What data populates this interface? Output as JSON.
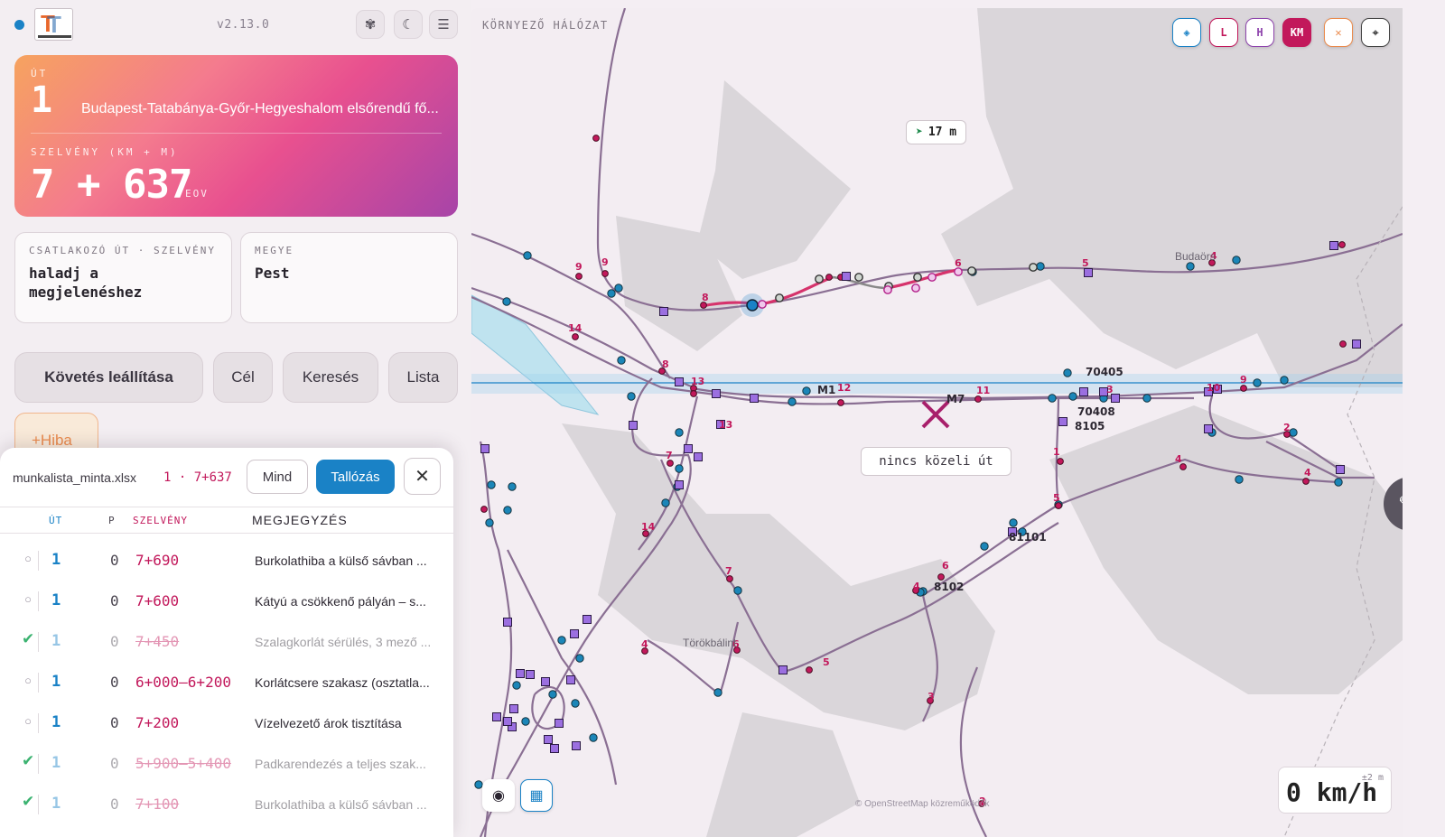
{
  "header": {
    "version": "v2.13.0",
    "icons": [
      "palette-icon",
      "moon-icon",
      "menu-icon"
    ]
  },
  "road_card": {
    "label": "ÚT",
    "number": "1",
    "name": "Budapest-Tatabánya-Győr-Hegyeshalom elsőrendű fő...",
    "km_label": "SZELVÉNY (KM + M)",
    "km_value": "7 + 637",
    "km_suffix": "EOV"
  },
  "junction": {
    "label": "CSATLAKOZÓ ÚT · SZELVÉNY",
    "value": "haladj a megjelenéshez"
  },
  "county": {
    "label": "MEGYE",
    "value": "Pest"
  },
  "actions": {
    "stop_tracking": "Követés leállítása",
    "target": "Cél",
    "search": "Keresés",
    "list": "Lista",
    "error": "+Hiba"
  },
  "worklist": {
    "file": "munkalista_minta.xlsx",
    "position": "1 · 7+637",
    "all_button": "Mind",
    "browse_button": "Tallózás",
    "columns": {
      "road": "ÚT",
      "p": "P",
      "km": "SZELVÉNY",
      "note": "MEGJEGYZÉS"
    },
    "rows": [
      {
        "status": "○",
        "done": false,
        "road": "1",
        "p": "0",
        "km": "7+690",
        "note": "Burkolathiba a külső sávban ..."
      },
      {
        "status": "○",
        "done": false,
        "road": "1",
        "p": "0",
        "km": "7+600",
        "note": "Kátyú a csökkenő pályán – s..."
      },
      {
        "status": "✔",
        "done": true,
        "road": "1",
        "p": "0",
        "km": "7+450",
        "note": "Szalagkorlát sérülés, 3 mező ..."
      },
      {
        "status": "○",
        "done": false,
        "road": "1",
        "p": "0",
        "km": "6+000–6+200",
        "note": "Korlátcsere szakasz (osztatla..."
      },
      {
        "status": "○",
        "done": false,
        "road": "1",
        "p": "0",
        "km": "7+200",
        "note": "Vízelvezető árok tisztítása"
      },
      {
        "status": "✔",
        "done": true,
        "road": "1",
        "p": "0",
        "km": "5+900–5+400",
        "note": "Padkarendezés a teljes szak..."
      },
      {
        "status": "✔",
        "done": true,
        "road": "1",
        "p": "0",
        "km": "7+100",
        "note": "Burkolathiba a külső sávban ..."
      }
    ]
  },
  "map": {
    "title": "KÖRNYEZŐ HÁLÓZAT",
    "tools": [
      {
        "label": "◈",
        "color": "#1a82c6"
      },
      {
        "label": "L",
        "color": "#c2185b"
      },
      {
        "label": "H",
        "color": "#8e44ad"
      },
      {
        "label": "KM",
        "color": "#ffffff",
        "bg": "#c2185b"
      },
      {
        "label": "✕",
        "color": "#ea8a4c"
      },
      {
        "label": "⌖",
        "color": "#444444"
      }
    ],
    "distance": "17 m",
    "no_road": "nincs közeli út",
    "speed": "0 km/h",
    "accuracy": "±2 m",
    "attribution": "© OpenStreetMap közreműködők",
    "places": [
      "Budaörs",
      "Törökbálint"
    ],
    "road_labels": [
      "M1",
      "M7",
      "70405",
      "70408",
      "8105",
      "81101",
      "8102"
    ],
    "km_markers": [
      "9",
      "9",
      "8",
      "8",
      "14",
      "13",
      "13",
      "12",
      "11",
      "7",
      "6",
      "5",
      "4",
      "14",
      "7",
      "6",
      "5",
      "4",
      "5",
      "4",
      "6",
      "4",
      "3",
      "2",
      "9",
      "2",
      "4",
      "3",
      "10",
      "1",
      "5"
    ],
    "colors": {
      "accent": "#1a82c6",
      "km": "#c2185b",
      "road": "#8a6f93",
      "area": "#d8d5d9"
    }
  }
}
